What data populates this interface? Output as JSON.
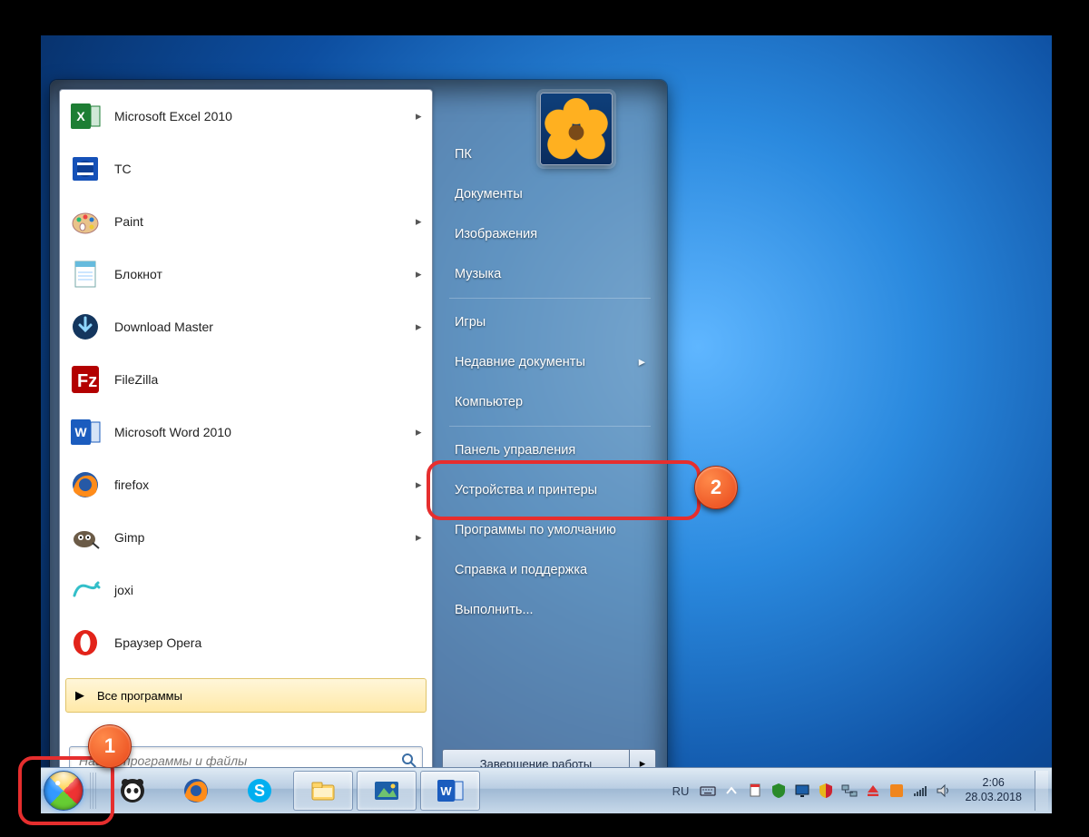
{
  "start_menu": {
    "programs": [
      {
        "label": "Microsoft Excel 2010",
        "icon": "excel",
        "has_submenu": true
      },
      {
        "label": "TC",
        "icon": "tc",
        "has_submenu": false
      },
      {
        "label": "Paint",
        "icon": "paint",
        "has_submenu": true
      },
      {
        "label": "Блокнот",
        "icon": "notepad",
        "has_submenu": true
      },
      {
        "label": "Download Master",
        "icon": "downloadmaster",
        "has_submenu": true
      },
      {
        "label": "FileZilla",
        "icon": "filezilla",
        "has_submenu": false
      },
      {
        "label": "Microsoft Word 2010",
        "icon": "word",
        "has_submenu": true
      },
      {
        "label": "firefox",
        "icon": "firefox",
        "has_submenu": true
      },
      {
        "label": "Gimp",
        "icon": "gimp",
        "has_submenu": true
      },
      {
        "label": "joxi",
        "icon": "joxi",
        "has_submenu": false
      },
      {
        "label": "Браузер Opera",
        "icon": "opera",
        "has_submenu": false
      }
    ],
    "all_programs_label": "Все программы",
    "search_value": "Найти программы и файлы",
    "right_items": [
      {
        "label": "ПК",
        "has_submenu": false,
        "group": 0
      },
      {
        "label": "Документы",
        "has_submenu": false,
        "group": 0
      },
      {
        "label": "Изображения",
        "has_submenu": false,
        "group": 0
      },
      {
        "label": "Музыка",
        "has_submenu": false,
        "group": 0
      },
      {
        "label": "Игры",
        "has_submenu": false,
        "group": 1
      },
      {
        "label": "Недавние документы",
        "has_submenu": true,
        "group": 1
      },
      {
        "label": "Компьютер",
        "has_submenu": false,
        "group": 1
      },
      {
        "label": "Панель управления",
        "has_submenu": false,
        "group": 2,
        "highlighted": true
      },
      {
        "label": "Устройства и принтеры",
        "has_submenu": false,
        "group": 2
      },
      {
        "label": "Программы по умолчанию",
        "has_submenu": false,
        "group": 2
      },
      {
        "label": "Справка и поддержка",
        "has_submenu": false,
        "group": 2
      },
      {
        "label": "Выполнить...",
        "has_submenu": false,
        "group": 2
      }
    ],
    "shutdown_label": "Завершение работы"
  },
  "taskbar": {
    "pinned": [
      {
        "icon": "panda",
        "name": "panda"
      },
      {
        "icon": "firefox",
        "name": "firefox"
      },
      {
        "icon": "skype",
        "name": "skype"
      },
      {
        "icon": "explorer",
        "name": "explorer"
      },
      {
        "icon": "gallery",
        "name": "gallery"
      },
      {
        "icon": "word",
        "name": "word"
      }
    ],
    "language": "RU",
    "tray_icons": [
      "keyboard",
      "chevron-up",
      "flag",
      "shield",
      "monitor",
      "network",
      "eject",
      "orange",
      "wifi",
      "volume"
    ],
    "clock_time": "2:06",
    "clock_date": "28.03.2018"
  },
  "annotations": {
    "badge1": "1",
    "badge2": "2"
  },
  "colors": {
    "highlight": "#e62e2e",
    "badge": "#ec5a22"
  }
}
